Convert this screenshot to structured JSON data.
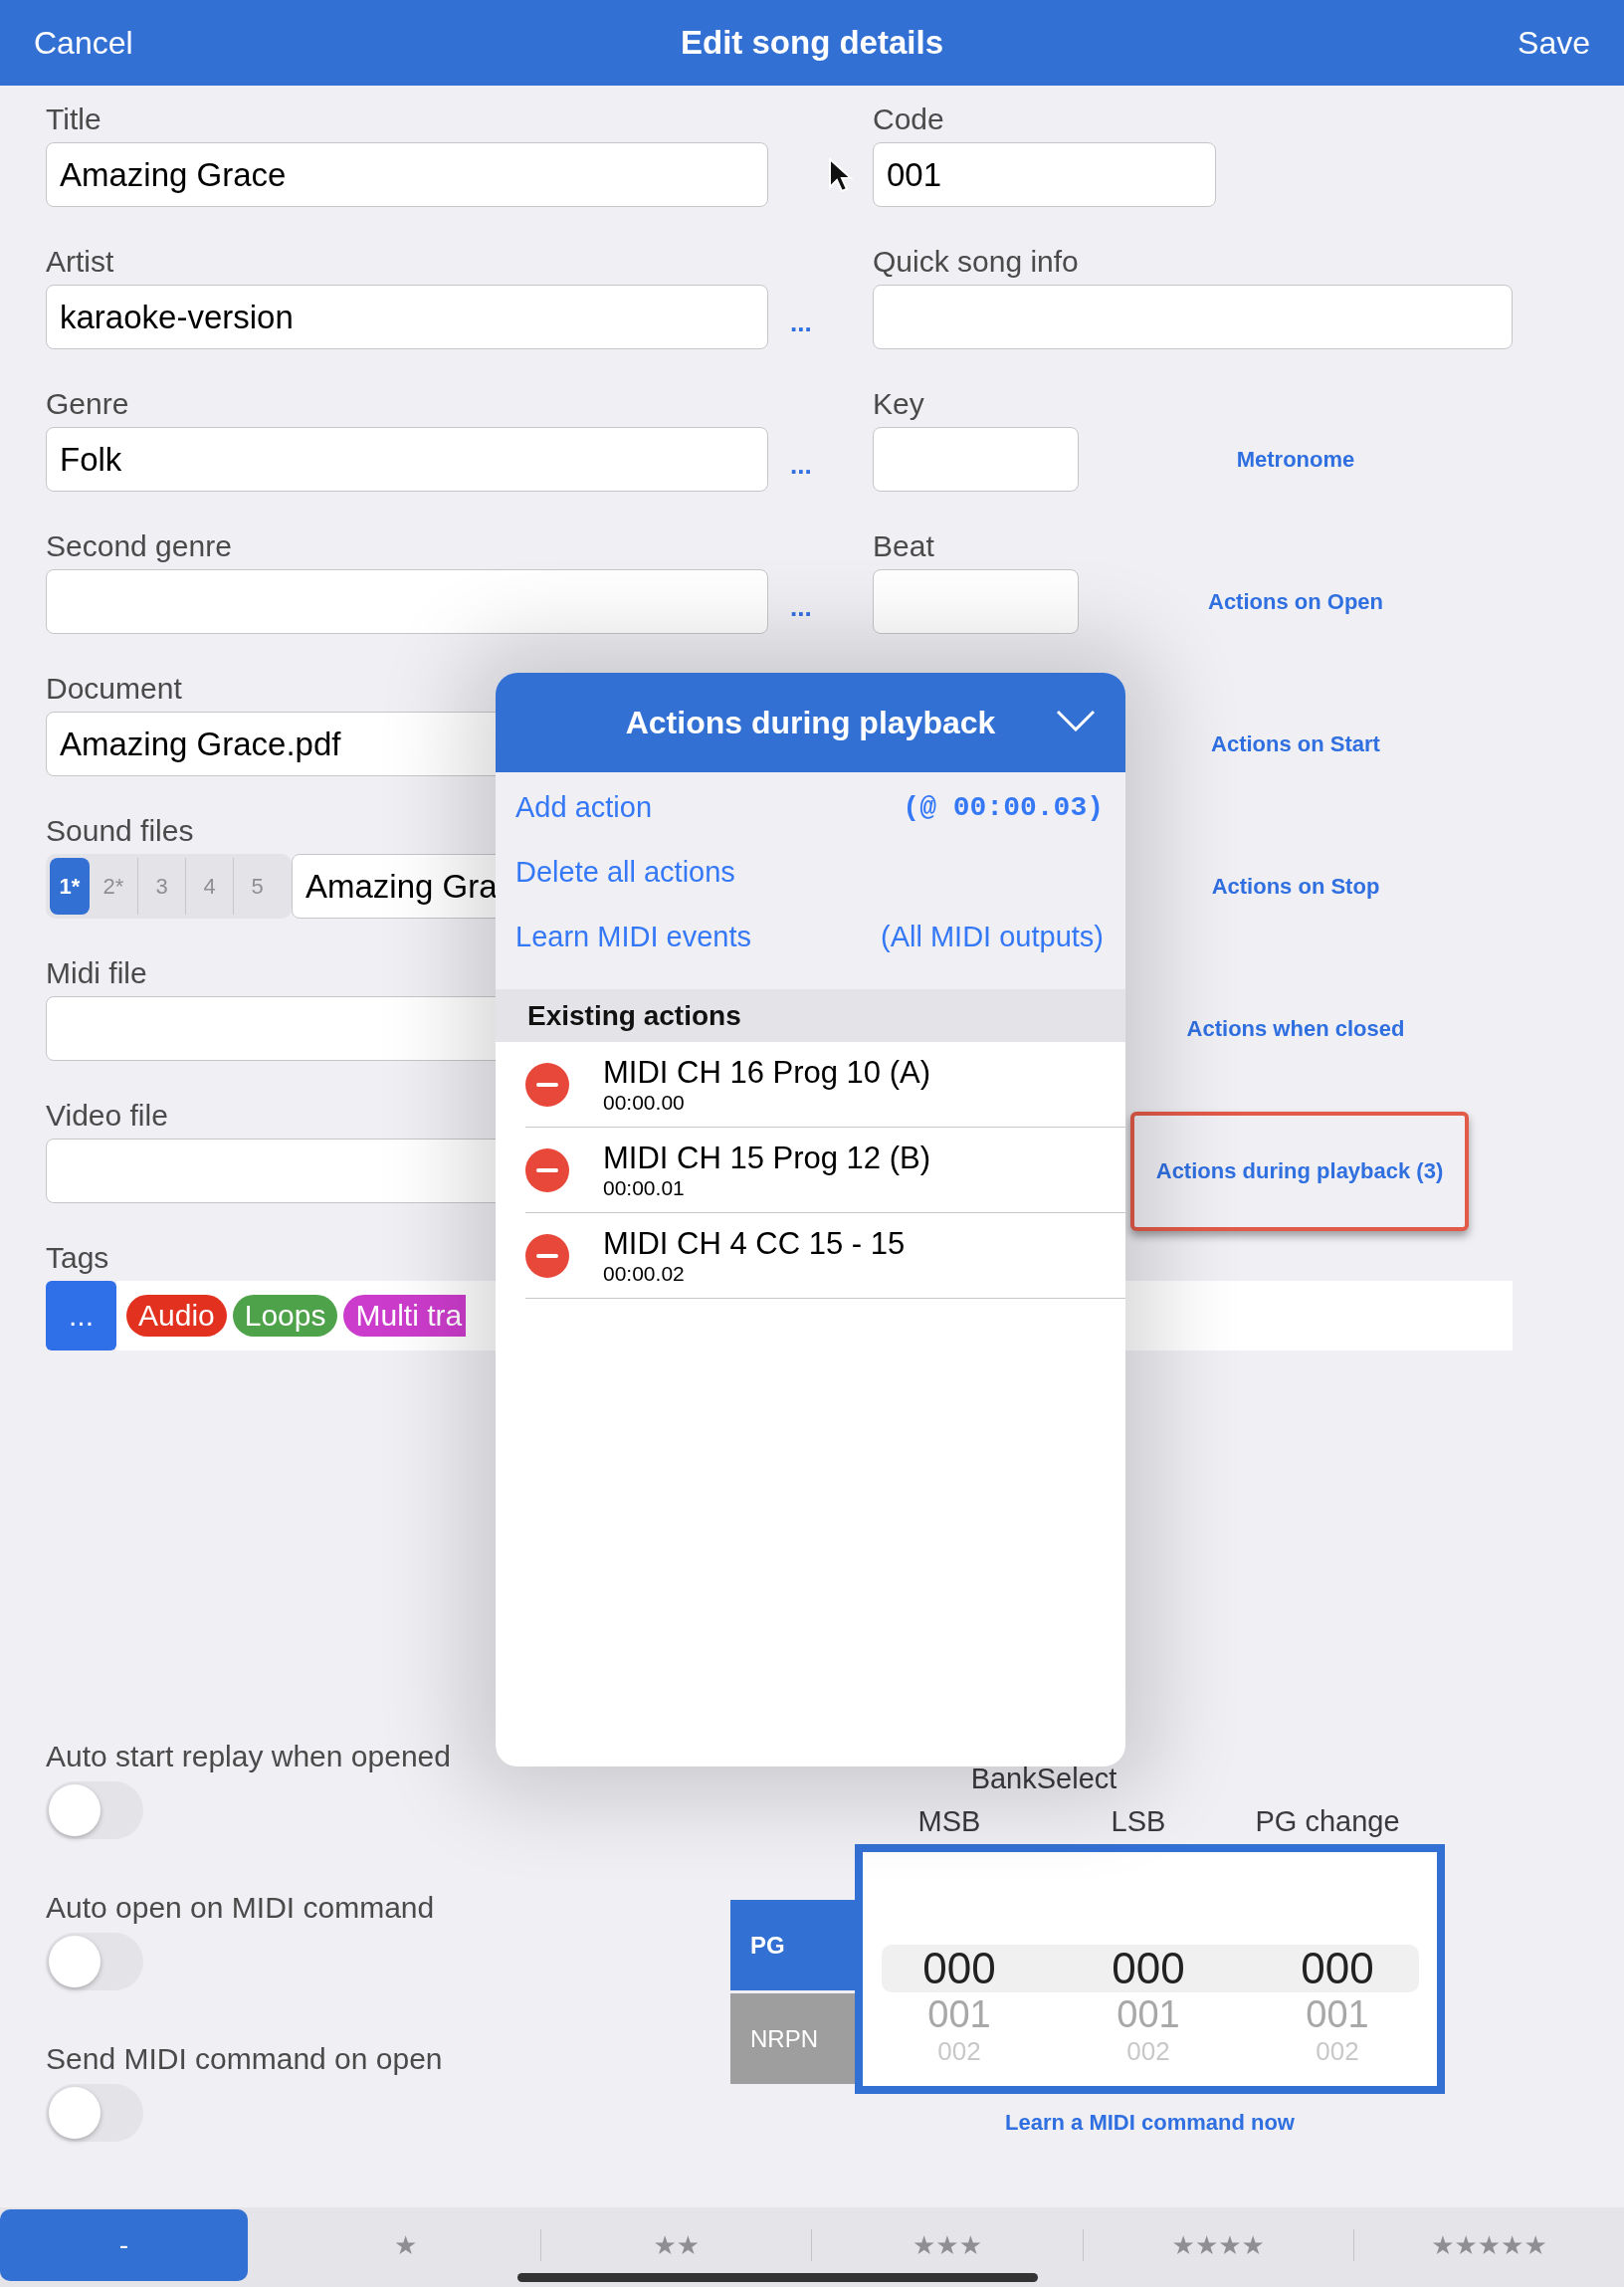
{
  "nav": {
    "cancel": "Cancel",
    "title": "Edit song details",
    "save": "Save"
  },
  "form_rows": [
    {
      "left": {
        "kind": "text",
        "label": "Title",
        "value": "Amazing Grace"
      },
      "right": {
        "kind": "medium",
        "label": "Code",
        "value": "001"
      }
    },
    {
      "left": {
        "kind": "text",
        "label": "Artist",
        "value": "karaoke-version",
        "more": "..."
      },
      "right": {
        "kind": "wide",
        "label": "Quick song info"
      }
    },
    {
      "left": {
        "kind": "text",
        "label": "Genre",
        "value": "Folk",
        "more": "..."
      },
      "right": {
        "kind": "short",
        "label": "Key"
      },
      "link": {
        "label": "Metronome",
        "highlighted": false
      }
    },
    {
      "left": {
        "kind": "text",
        "label": "Second genre",
        "more": "..."
      },
      "right": {
        "kind": "short",
        "label": "Beat"
      },
      "link": {
        "label": "Actions on Open",
        "highlighted": false
      }
    },
    {
      "left": {
        "kind": "text",
        "label": "Document",
        "value": "Amazing Grace.pdf"
      },
      "link": {
        "label": "Actions on Start",
        "highlighted": false
      }
    },
    {
      "left": {
        "kind": "sound",
        "label": "Sound files",
        "slots": [
          {
            "label": "1*",
            "selected": true
          },
          {
            "label": "2*",
            "selected": false
          },
          {
            "label": "3",
            "selected": false
          },
          {
            "label": "4",
            "selected": false
          },
          {
            "label": "5",
            "selected": false
          }
        ],
        "value": "Amazing Gra"
      },
      "link": {
        "label": "Actions on Stop",
        "highlighted": false
      }
    },
    {
      "left": {
        "kind": "text",
        "label": "Midi file"
      },
      "link": {
        "label": "Actions when closed",
        "highlighted": false
      }
    },
    {
      "left": {
        "kind": "text",
        "label": "Video file"
      },
      "link": {
        "label": "Actions during playback (3)",
        "highlighted": true
      }
    },
    {
      "left": {
        "kind": "tags",
        "label": "Tags",
        "button": "...",
        "tags": [
          {
            "label": "Audio",
            "color": "#e2321f"
          },
          {
            "label": "Loops",
            "color": "#4ea24a"
          },
          {
            "label": "Multi tra",
            "color": "#cc3ccc"
          }
        ]
      }
    }
  ],
  "toggles": [
    {
      "label": "Auto start replay when opened",
      "on": false
    },
    {
      "label": "Auto open on MIDI command",
      "on": false
    },
    {
      "label": "Send MIDI command on open",
      "on": false
    }
  ],
  "midi": {
    "heading": "BankSelect",
    "columns": [
      "MSB",
      "LSB",
      "PG change"
    ],
    "modes": [
      {
        "label": "PG",
        "selected": true
      },
      {
        "label": "NRPN",
        "selected": false
      }
    ],
    "wheels": [
      {
        "values": [
          "000",
          "001",
          "002"
        ]
      },
      {
        "values": [
          "000",
          "001",
          "002"
        ]
      },
      {
        "values": [
          "000",
          "001",
          "002"
        ]
      }
    ],
    "learn": "Learn a MIDI command now"
  },
  "rating_tabs": [
    {
      "label": "-",
      "selected": true
    },
    {
      "label": "★",
      "selected": false
    },
    {
      "label": "★★",
      "selected": false
    },
    {
      "label": "★★★",
      "selected": false
    },
    {
      "label": "★★★★",
      "selected": false
    },
    {
      "label": "★★★★★",
      "selected": false
    }
  ],
  "popover": {
    "title": "Actions during playback",
    "menu": [
      {
        "label": "Add action",
        "detail": "(@ 00:00.03)",
        "kind": "time"
      },
      {
        "label": "Delete all actions"
      },
      {
        "label": "Learn MIDI events",
        "detail": "(All MIDI outputs)",
        "kind": "outputs"
      }
    ],
    "section": "Existing actions",
    "actions": [
      {
        "name": "MIDI CH 16 Prog 10 (A)",
        "time": "00:00.00"
      },
      {
        "name": "MIDI CH 15 Prog 12 (B)",
        "time": "00:00.01"
      },
      {
        "name": "MIDI CH 4 CC 15 - 15",
        "time": "00:00.02"
      }
    ]
  }
}
